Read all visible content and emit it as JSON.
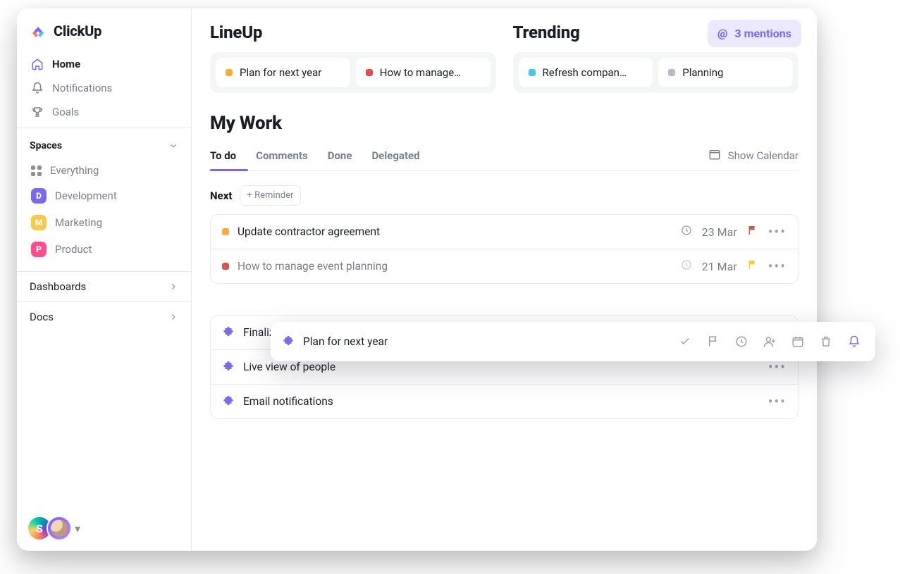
{
  "brand": {
    "name": "ClickUp"
  },
  "sidebar": {
    "nav": [
      {
        "label": "Home"
      },
      {
        "label": "Notifications"
      },
      {
        "label": "Goals"
      }
    ],
    "spaces_header": "Spaces",
    "spaces": [
      {
        "label": "Everything"
      },
      {
        "letter": "D",
        "label": "Development",
        "color": "#7b68ee"
      },
      {
        "letter": "M",
        "label": "Marketing",
        "color": "#f7c948"
      },
      {
        "letter": "P",
        "label": "Product",
        "color": "#ff4d8d"
      }
    ],
    "links": [
      {
        "label": "Dashboards"
      },
      {
        "label": "Docs"
      }
    ]
  },
  "mentions": {
    "label": "3 mentions"
  },
  "lineup": {
    "title": "LineUp",
    "cards": [
      {
        "label": "Plan for next year",
        "color": "#fdab3d"
      },
      {
        "label": "How to manage…",
        "color": "#e04f4f"
      }
    ]
  },
  "trending": {
    "title": "Trending",
    "cards": [
      {
        "label": "Refresh compan…",
        "color": "#49c4ec"
      },
      {
        "label": "Planning",
        "color": "#b7bbc4"
      }
    ]
  },
  "mywork": {
    "title": "My Work",
    "tabs": [
      "To do",
      "Comments",
      "Done",
      "Delegated"
    ],
    "calendar_label": "Show Calendar",
    "group_title": "Next",
    "reminder_label": "+ Reminder",
    "tasks": [
      {
        "dot": "#fdab3d",
        "title": "Update contractor agreement",
        "date": "23 Mar",
        "flag": "#e04f4f"
      },
      {
        "dot": "#e04f4f",
        "title": "How to manage event planning",
        "date": "21 Mar",
        "flag": "#f7c948",
        "faded": true
      }
    ],
    "items": [
      {
        "title": "Finalize project scope"
      },
      {
        "title": "Live view of people"
      },
      {
        "title": "Email notifications"
      }
    ]
  },
  "float": {
    "title": "Plan for next year"
  }
}
